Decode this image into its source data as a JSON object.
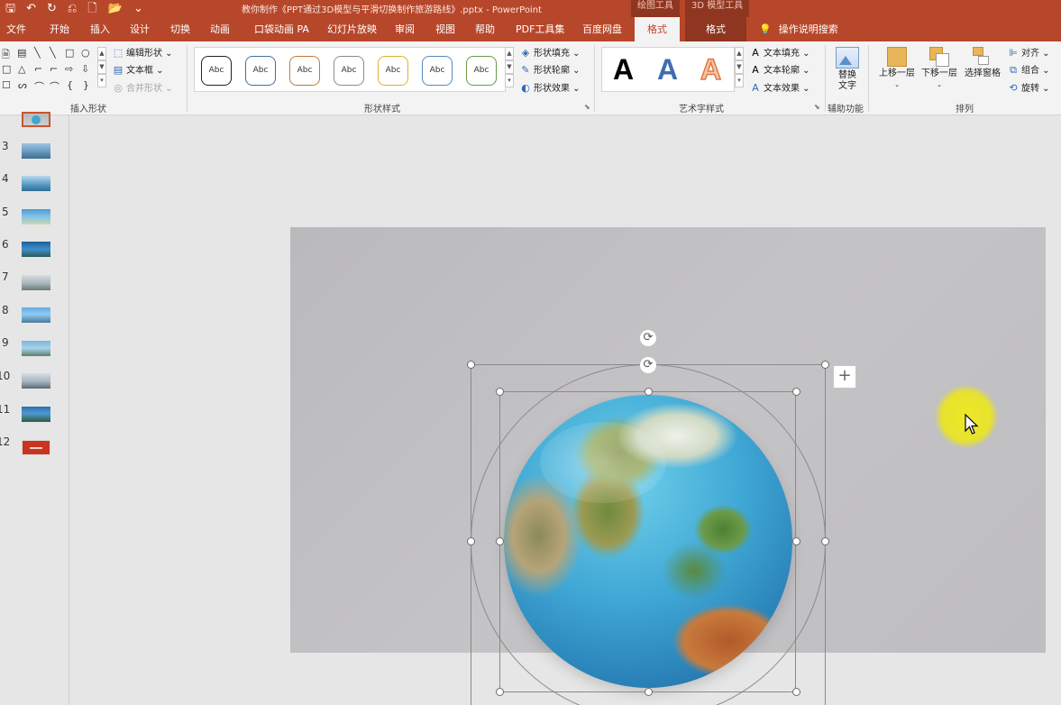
{
  "titlebar": {
    "qat": {
      "save": "🖫",
      "undo": "↶",
      "redo": "↻",
      "touch": "⎌",
      "new": "🗋",
      "open": "📂",
      "customize": "⌄"
    },
    "title": "教你制作《PPT通过3D模型与平滑切换制作旅游路线》.pptx  -  PowerPoint",
    "context_drawing": "绘图工具",
    "context_3d": "3D 模型工具"
  },
  "tabs": {
    "file": "文件",
    "home": "开始",
    "insert": "插入",
    "design": "设计",
    "transitions": "切换",
    "animations": "动画",
    "pocket": "口袋动画 PA",
    "slideshow": "幻灯片放映",
    "review": "审阅",
    "view": "视图",
    "help": "帮助",
    "pdf": "PDF工具集",
    "baidu": "百度网盘",
    "format_drawing": "格式",
    "format_3d": "格式",
    "tellme": "操作说明搜索"
  },
  "ribbon": {
    "insert_shapes": {
      "label": "插入形状",
      "edit_shape": "编辑形状",
      "textbox": "文本框",
      "merge": "合并形状",
      "shapes_row1": [
        "🗎",
        "▤",
        "╲",
        "╲",
        "□",
        "○"
      ],
      "shapes_row2": [
        "□",
        "△",
        "⌐",
        "⌐",
        "⇨",
        "⇩"
      ],
      "shapes_row3": [
        "☐",
        "ᔕ",
        "⌒",
        "⌒",
        "{",
        "}"
      ]
    },
    "shape_styles": {
      "label": "形状样式",
      "swatches": [
        "Abc",
        "Abc",
        "Abc",
        "Abc",
        "Abc",
        "Abc",
        "Abc"
      ],
      "swatch_colors": [
        "#222222",
        "#44709a",
        "#c07a3a",
        "#8a8a8a",
        "#d8b52e",
        "#5a88b8",
        "#6a9a46"
      ],
      "fill": "形状填充",
      "outline": "形状轮廓",
      "effects": "形状效果"
    },
    "wordart": {
      "label": "艺术字样式",
      "samples": [
        "A",
        "A",
        "A"
      ],
      "text_fill": "文本填充",
      "text_outline": "文本轮廓",
      "text_effects": "文本效果"
    },
    "accessibility": {
      "label": "辅助功能",
      "alt_text_line1": "替换",
      "alt_text_line2": "文字"
    },
    "arrange": {
      "label": "排列",
      "bring_forward": "上移一层",
      "send_backward": "下移一层",
      "selection_pane": "选择窗格",
      "align": "对齐",
      "group": "组合",
      "rotate": "旋转"
    }
  },
  "thumbnails": {
    "numbers": [
      "",
      "3",
      "4",
      "5",
      "6",
      "7",
      "8",
      "9",
      "10",
      "11",
      "12"
    ]
  },
  "colors": {
    "accent": "#b7472a",
    "context_tab": "#8e3620"
  }
}
